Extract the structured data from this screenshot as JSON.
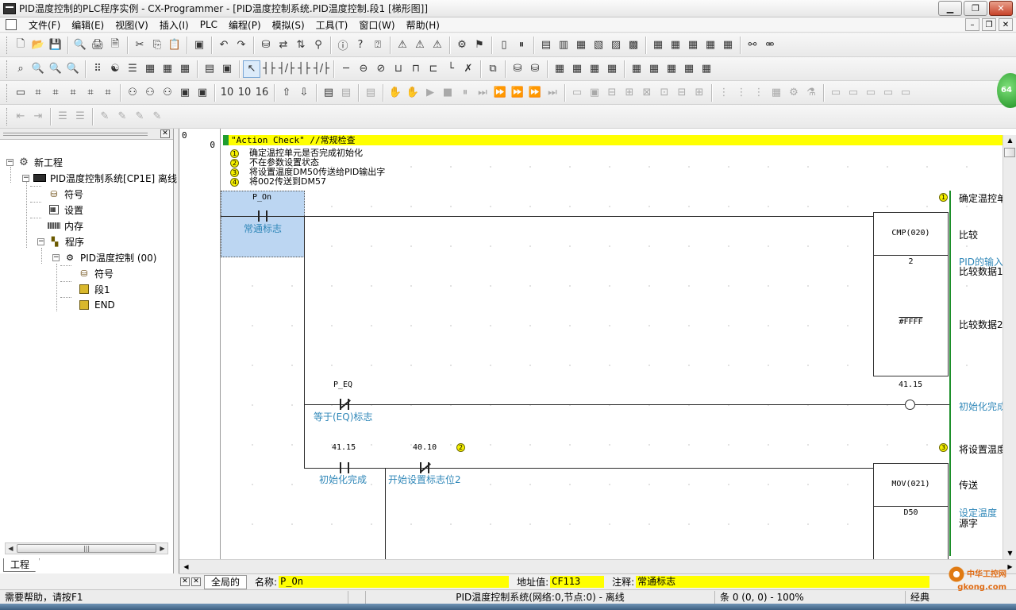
{
  "window": {
    "title": "PID温度控制的PLC程序实例 - CX-Programmer - [PID温度控制系统.PID温度控制.段1 [梯形图]]",
    "min_label": "▁",
    "max_label": "❐",
    "close_label": "✕"
  },
  "menu": {
    "items": [
      "文件(F)",
      "编辑(E)",
      "视图(V)",
      "插入(I)",
      "PLC",
      "编程(P)",
      "模拟(S)",
      "工具(T)",
      "窗口(W)",
      "帮助(H)"
    ],
    "mdi_min": "–",
    "mdi_restore": "❐",
    "mdi_close": "✕"
  },
  "toolbars": {
    "row1": [
      "🗋",
      "📂",
      "💾",
      "|",
      "🔍",
      "🖨",
      "🗎",
      "|",
      "✂",
      "⎘",
      "📋",
      "|",
      "▣",
      "|",
      "↶",
      "↷",
      "|",
      "⛁",
      "⇄",
      "⇅",
      "⚲",
      "|",
      "ⓘ",
      "?",
      "⍰",
      "|",
      "⚠",
      "⚠",
      "⚠",
      "|",
      "⚙",
      "⚑",
      "|",
      "▯",
      "⏸",
      "|",
      "▤",
      "▥",
      "▦",
      "▧",
      "▨",
      "▩",
      "|",
      "▦",
      "▦",
      "▦",
      "▦",
      "▦",
      "|",
      "⚯",
      "⚮"
    ],
    "row2": [
      "⌕",
      "🔍",
      "🔍",
      "🔍",
      "|",
      "⠿",
      "☯",
      "☰",
      "▦",
      "▦",
      "▦",
      "|",
      "▤",
      "▣",
      "|",
      "↖",
      "┤├",
      "┤/├",
      "┤├",
      "┤/├",
      "|",
      "─",
      "⊖",
      "⊘",
      "⊔",
      "⊓",
      "⊏",
      "└",
      "✗",
      "|",
      "⧉",
      "|",
      "⛁",
      "⛁",
      "|",
      "▦",
      "▦",
      "▦",
      "▦",
      "|",
      "▦",
      "▦",
      "▦",
      "▦",
      "▦"
    ],
    "row3": [
      "▭",
      "⌗",
      "⌗",
      "⌗",
      "⌗",
      "⌗",
      "|",
      "⚇",
      "⚇",
      "⚇",
      "▣",
      "▣",
      "|",
      "10",
      "10",
      "16",
      "|",
      "⇧",
      "⇩",
      "|",
      "▤",
      "▤",
      "|",
      "▤",
      "|",
      "✋",
      "✋",
      "▶",
      "■",
      "⏸",
      "⏭",
      "⏩",
      "⏩",
      "⏩",
      "⏭",
      "|",
      "▭",
      "▣",
      "⊟",
      "⊞",
      "⊠",
      "⊡",
      "⊟",
      "⊞",
      "|",
      "⋮",
      "⋮",
      "⋮",
      "▦",
      "⚙",
      "⚗",
      "|",
      "▭",
      "▭",
      "▭",
      "▭",
      "▭"
    ],
    "row4": [
      "⇤",
      "⇥",
      "|",
      "☰",
      "☰",
      "|",
      "✎",
      "✎",
      "✎",
      "✎"
    ]
  },
  "project": {
    "tab": "工程",
    "tree": {
      "root": "新工程",
      "plc": "PID温度控制系统[CP1E] 离线",
      "symbols": "符号",
      "settings": "设置",
      "memory": "内存",
      "programs": "程序",
      "task": "PID温度控制 (00)",
      "task_symbols": "符号",
      "section1": "段1",
      "end": "END"
    }
  },
  "ladder": {
    "rung_number": "0",
    "rung_addr": "0",
    "comment_title": "\"Action Check\" //常规检查",
    "comment_lines": [
      {
        "n": "1",
        "text": "确定温控单元是否完成初始化"
      },
      {
        "n": "2",
        "text": "不在参数设置状态"
      },
      {
        "n": "3",
        "text": "将设置温度DM50传送给PID输出字"
      },
      {
        "n": "4",
        "text": "将002传送到DM57"
      }
    ],
    "c1_op": "P_On",
    "c1_comment": "常通标志",
    "cmp_name": "CMP(020)",
    "cmp_op1": "2",
    "cmp_op2": "#FFFF",
    "r1_note_num": "1",
    "r1_note": "确定温控单",
    "cmp_desc": "比较",
    "cmp_op1_comment": "PID的输入",
    "cmp_op1_desc": "比较数据1",
    "cmp_op2_desc": "比较数据2",
    "c2_op": "P_EQ",
    "c2_comment": "等于(EQ)标志",
    "coil_op": "41.15",
    "coil_comment": "初始化完成",
    "c3_op": "41.15",
    "c3_comment": "初始化完成",
    "c4_op": "40.10",
    "c4_comment": "开始设置标志位2",
    "c4_note_num": "2",
    "r3_note_num": "3",
    "r3_note": "将设置温度",
    "mov_name": "MOV(021)",
    "mov_desc": "传送",
    "mov_op1": "D50",
    "mov_op1_comment": "设定温度",
    "mov_op1_desc": "源字"
  },
  "infobar": {
    "tab": "全局的",
    "name_label": "名称:",
    "name_value": "P_On",
    "addr_label": "地址值:",
    "addr_value": "CF113",
    "comment_label": "注释:",
    "comment_value": "常通标志"
  },
  "status": {
    "help": "需要帮助，请按F1",
    "net": "PID温度控制系统(网络:0,节点:0) - 离线",
    "pos": "条 0 (0, 0)  - 100%",
    "mode": "经典"
  },
  "badge": "64",
  "watermark": {
    "line1": "中华工控网",
    "line2": "gkong.com"
  }
}
